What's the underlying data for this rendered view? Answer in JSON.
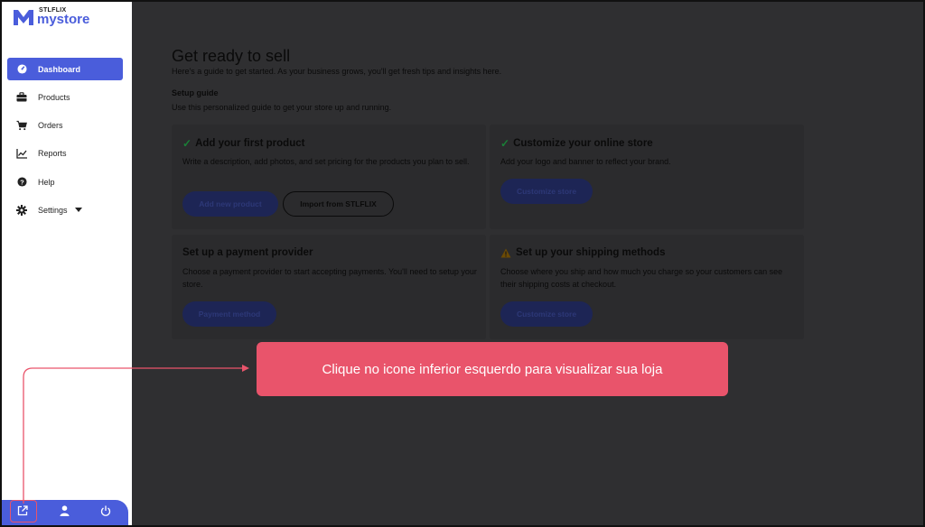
{
  "brand": {
    "small": "STLFLIX",
    "big": "mystore",
    "accent": "#4a5ddb"
  },
  "sidebar": {
    "items": [
      {
        "label": "Dashboard",
        "icon": "dashboard-icon",
        "active": true
      },
      {
        "label": "Products",
        "icon": "briefcase-icon"
      },
      {
        "label": "Orders",
        "icon": "cart-icon"
      },
      {
        "label": "Reports",
        "icon": "chart-line-icon"
      },
      {
        "label": "Help",
        "icon": "help-icon"
      },
      {
        "label": "Settings",
        "icon": "gear-icon"
      }
    ],
    "bottom": [
      "external-link-icon",
      "user-icon",
      "power-icon"
    ]
  },
  "main": {
    "title": "Get ready to sell",
    "subtitle": "Here's a guide to get started. As your business grows, you'll get fresh tips and insights here.",
    "setup_title": "Setup guide",
    "setup_sub": "Use this personalized guide to get your store up and running.",
    "cards": [
      {
        "title": "Add your first product",
        "desc": "Write a description, add photos, and set pricing for the products you plan to sell.",
        "buttons": [
          "Add new product",
          "Import from STLFLIX"
        ]
      },
      {
        "title": "Customize your online store",
        "desc": "Add your logo and banner to reflect your brand.",
        "buttons": [
          "Customize store"
        ]
      },
      {
        "title": "Set up a payment provider",
        "desc": "Choose a payment provider to start accepting payments. You'll need to setup your store.",
        "buttons": [
          "Payment method"
        ]
      },
      {
        "title": "Set up your shipping methods",
        "desc": "Choose where you ship and how much you charge so your customers can see their shipping costs at checkout.",
        "buttons": [
          "Customize store"
        ]
      }
    ]
  },
  "callout": {
    "text": "Clique no icone inferior esquerdo para visualizar sua loja",
    "color": "#e9546b"
  }
}
